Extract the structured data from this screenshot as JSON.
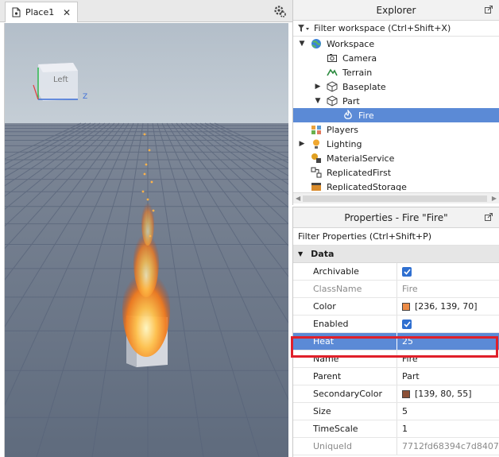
{
  "viewport": {
    "tab_label": "Place1",
    "close_glyph": "✕",
    "viewcube_face": "Left",
    "axis_z": "Z"
  },
  "explorer": {
    "title": "Explorer",
    "filter_placeholder": "Filter workspace (Ctrl+Shift+X)",
    "tree": [
      {
        "label": "Workspace",
        "indent": 0,
        "expanded": true,
        "icon": "globe-icon"
      },
      {
        "label": "Camera",
        "indent": 1,
        "icon": "camera-icon"
      },
      {
        "label": "Terrain",
        "indent": 1,
        "icon": "terrain-icon"
      },
      {
        "label": "Baseplate",
        "indent": 1,
        "collapsed": true,
        "icon": "part-icon"
      },
      {
        "label": "Part",
        "indent": 1,
        "expanded": true,
        "icon": "part-icon"
      },
      {
        "label": "Fire",
        "indent": 2,
        "selected": true,
        "icon": "fire-icon"
      },
      {
        "label": "Players",
        "indent": 0,
        "icon": "players-icon"
      },
      {
        "label": "Lighting",
        "indent": 0,
        "collapsed": true,
        "icon": "lighting-icon"
      },
      {
        "label": "MaterialService",
        "indent": 0,
        "icon": "material-service-icon"
      },
      {
        "label": "ReplicatedFirst",
        "indent": 0,
        "icon": "replicated-first-icon"
      },
      {
        "label": "ReplicatedStorage",
        "indent": 0,
        "icon": "replicated-storage-icon"
      }
    ]
  },
  "properties": {
    "title": "Properties - Fire \"Fire\"",
    "filter_placeholder": "Filter Properties (Ctrl+Shift+P)",
    "section": "Data",
    "rows": [
      {
        "name": "Archivable",
        "type": "checkbox",
        "checked": true
      },
      {
        "name": "ClassName",
        "value": "Fire",
        "readonly": true
      },
      {
        "name": "Color",
        "type": "color",
        "swatch": "#ec8b46",
        "value": "[236, 139, 70]"
      },
      {
        "name": "Enabled",
        "type": "checkbox",
        "checked": true
      },
      {
        "name": "Heat",
        "value": "25",
        "highlight": true
      },
      {
        "name": "Name",
        "value": "Fire"
      },
      {
        "name": "Parent",
        "value": "Part"
      },
      {
        "name": "SecondaryColor",
        "type": "color",
        "swatch": "#8b5037",
        "value": "[139, 80, 55]"
      },
      {
        "name": "Size",
        "value": "5"
      },
      {
        "name": "TimeScale",
        "value": "1"
      },
      {
        "name": "UniqueId",
        "value": "7712fd68394c7d8407...",
        "readonly": true
      }
    ]
  },
  "colors": {
    "selection": "#5b8ad6",
    "highlight_outline": "#e0202a",
    "sky": "#b8c2cc",
    "floor": "#6f7b8c"
  }
}
